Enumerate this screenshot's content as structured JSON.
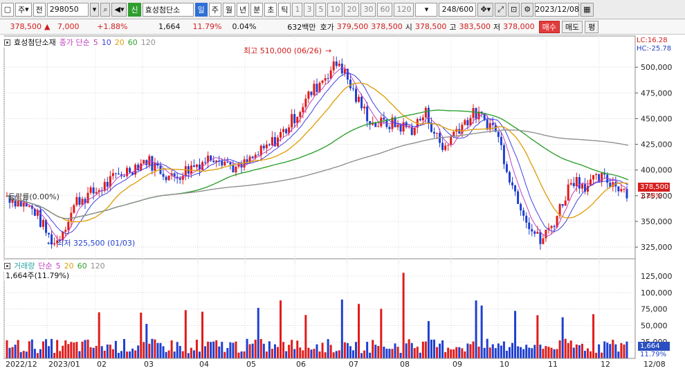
{
  "toolbar": {
    "type": "주",
    "type2": "전",
    "code": "298050",
    "name": "효성첨단소",
    "periods": [
      "일",
      "주",
      "월",
      "년",
      "분",
      "초",
      "틱"
    ],
    "numbers": [
      "1",
      "3",
      "5",
      "10",
      "20",
      "30",
      "60",
      "120"
    ],
    "count": "248/600",
    "date": "2023/12/08"
  },
  "quote": {
    "price": "378,500",
    "change": "7,000",
    "change_pct": "+1.88%",
    "volume": "1,664",
    "turnover": "11.79%",
    "ratio": "0.04%",
    "amount": "632백만",
    "bid_label": "호가",
    "bid": "379,500",
    "ask": "378,500",
    "open_label": "시",
    "open": "378,500",
    "high_label": "고",
    "high": "383,500",
    "low_label": "저",
    "low": "378,000",
    "buy": "매수",
    "sell": "매도",
    "eq": "평"
  },
  "price_panel": {
    "name": "효성첨단소재",
    "legend_label": "종가 단순",
    "ma": [
      "5",
      "10",
      "20",
      "60",
      "120"
    ],
    "lc": "LC:16.28",
    "hc": "HC:-25.78",
    "high_note": "최고 510,000 (06/26)",
    "low_note": "최저 325,500 (01/03)",
    "drop_note": "등락률(0.00%)",
    "cur_price": "378,500",
    "cur_pct": "1.88%"
  },
  "volume_panel": {
    "label": "거래량",
    "legend_label": "단순",
    "ma": [
      "5",
      "20",
      "60",
      "120"
    ],
    "value_note": "1,664주(11.79%)",
    "cur_vol": "1,664",
    "cur_pct": "11.79%"
  },
  "colors": {
    "up": "#e01b1b",
    "down": "#1f3fd0",
    "ma5": "#c040c0",
    "ma10": "#4040e0",
    "ma20": "#e0a010",
    "ma60": "#30a030",
    "ma120": "#909090"
  },
  "chart_data": {
    "type": "candlestick",
    "y_ticks": [
      500000,
      475000,
      450000,
      425000,
      400000,
      375000,
      350000,
      325000
    ],
    "y_range": [
      315000,
      525000
    ],
    "vol_ticks": [
      125000,
      100000,
      75000,
      50000,
      25000
    ],
    "vol_range": [
      0,
      145000
    ],
    "x_labels": [
      "2022/12",
      "2023/01",
      "02",
      "03",
      "04",
      "05",
      "06",
      "07",
      "08",
      "09",
      "10",
      "11",
      "12",
      "12/08"
    ],
    "monthly_close": [
      {
        "month": "2022/12",
        "close": 375000
      },
      {
        "month": "2023/01",
        "close": 378000
      },
      {
        "month": "02",
        "close": 405000
      },
      {
        "month": "03",
        "close": 418000
      },
      {
        "month": "04",
        "close": 408000
      },
      {
        "month": "05",
        "close": 412000
      },
      {
        "month": "06",
        "close": 488000
      },
      {
        "month": "07",
        "close": 445000
      },
      {
        "month": "08",
        "close": 440000
      },
      {
        "month": "09",
        "close": 450000
      },
      {
        "month": "10",
        "close": 345000
      },
      {
        "month": "11",
        "close": 392000
      },
      {
        "month": "12",
        "close": 378500
      }
    ]
  }
}
